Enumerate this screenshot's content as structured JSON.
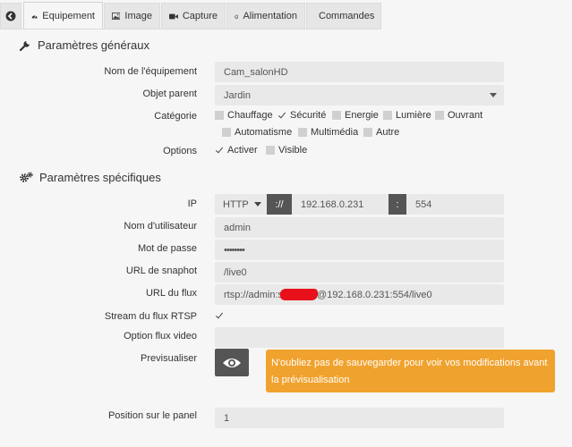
{
  "tabs": [
    {
      "label": "Equipement",
      "icon": "tachometer-icon",
      "active": true
    },
    {
      "label": "Image",
      "icon": "image-icon"
    },
    {
      "label": "Capture",
      "icon": "video-camera-icon"
    },
    {
      "label": "Alimentation",
      "icon": "power-icon"
    },
    {
      "label": "Commandes",
      "icon": "list-icon"
    }
  ],
  "general": {
    "title": "Paramètres généraux",
    "equipment_name_label": "Nom de l'équipement",
    "equipment_name": "Cam_salonHD",
    "parent_label": "Objet parent",
    "parent_value": "Jardin",
    "category_label": "Catégorie",
    "categories": [
      {
        "label": "Chauffage",
        "checked": false
      },
      {
        "label": "Sécurité",
        "checked": true
      },
      {
        "label": "Energie",
        "checked": false
      },
      {
        "label": "Lumière",
        "checked": false
      },
      {
        "label": "Ouvrant",
        "checked": false
      },
      {
        "label": "Automatisme",
        "checked": false
      },
      {
        "label": "Multimédia",
        "checked": false
      },
      {
        "label": "Autre",
        "checked": false
      }
    ],
    "options_label": "Options",
    "options": [
      {
        "label": "Activer",
        "checked": true
      },
      {
        "label": "Visible",
        "checked": false
      }
    ]
  },
  "specific": {
    "title": "Paramètres spécifiques",
    "ip_label": "IP",
    "protocol": "HTTP",
    "proto_sep": "://",
    "ip": "192.168.0.231",
    "port_sep": ":",
    "port": "554",
    "username_label": "Nom d'utilisateur",
    "username": "admin",
    "password_label": "Mot de passe",
    "password": "••••••••",
    "snapshot_label": "URL de snaphot",
    "snapshot": "/live0",
    "stream_label": "URL du flux",
    "stream_prefix": "rtsp://admin:s",
    "stream_suffix": "@192.168.0.231:554/live0",
    "rtsp_label": "Stream du flux RTSP",
    "rtsp_checked": true,
    "video_option_label": "Option flux video",
    "video_option": "",
    "preview_label": "Previsualiser",
    "alert": "N'oubliez pas de sauvegarder pour voir vos modifications avant la prévisualisation",
    "position_label": "Position sur le panel",
    "position": "1"
  },
  "colors": {
    "alert": "#f0a22e",
    "dark_button": "#555555",
    "redaction": "#e8101a"
  }
}
